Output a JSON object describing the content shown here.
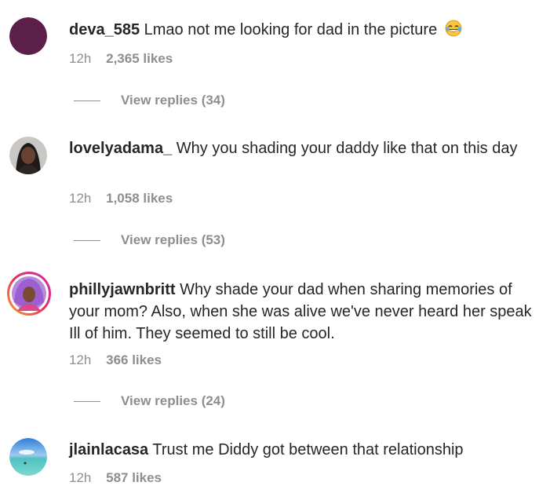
{
  "comments": [
    {
      "username": "deva_585",
      "text": "Lmao not me looking for dad in the picture",
      "emoji": "face-with-tears-of-joy-icon",
      "time": "12h",
      "likes": "2,365 likes",
      "replies": "View replies (34)",
      "avatar_color": "#5b1f4a"
    },
    {
      "username": "lovelyadama_",
      "text": "Why you shading your daddy like that on this day",
      "time": "12h",
      "likes": "1,058 likes",
      "replies": "View replies (53)"
    },
    {
      "username": "phillyjawnbritt",
      "text": "Why shade your dad when sharing memories of your mom? Also, when she was alive we've never heard her speak Ill of him. They seemed to still be cool.",
      "time": "12h",
      "likes": "366 likes",
      "replies": "View replies (24)"
    },
    {
      "username": "jlainlacasa",
      "text": "Trust me Diddy got between that relationship",
      "time": "12h",
      "likes": "587 likes"
    }
  ],
  "colors": {
    "text": "#262626",
    "secondary": "#8e8e8e",
    "story_ring_start": "#f9a52b",
    "story_ring_end": "#c92bb7"
  }
}
